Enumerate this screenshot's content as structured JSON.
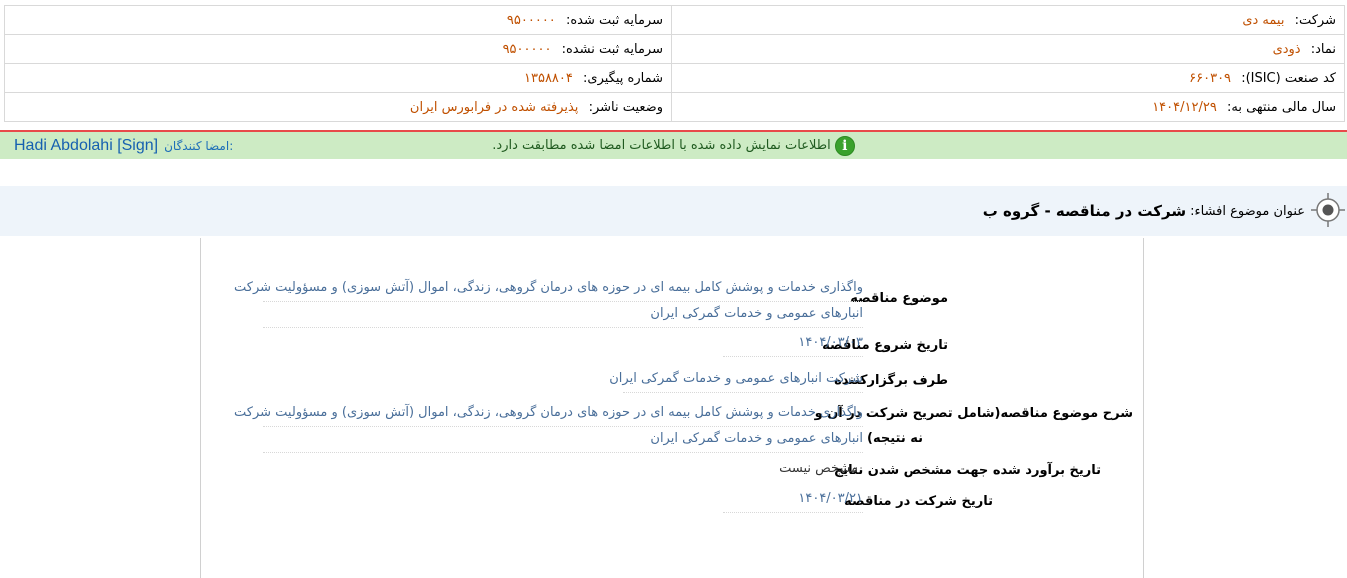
{
  "company": {
    "company_label": "شرکت:",
    "company_value": "بیمه دی",
    "symbol_label": "نماد:",
    "symbol_value": "ذودی",
    "isic_label": "کد صنعت (ISIC):",
    "isic_value": "۶۶۰۳۰۹",
    "fiscal_label": "سال مالی منتهی به:",
    "fiscal_value": "۱۴۰۴/۱۲/۲۹",
    "registered_capital_label": "سرمایه ثبت شده:",
    "registered_capital_value": "۹۵۰۰۰۰۰",
    "unregistered_capital_label": "سرمایه ثبت نشده:",
    "unregistered_capital_value": "۹۵۰۰۰۰۰",
    "tracking_label": "شماره پیگیری:",
    "tracking_value": "۱۳۵۸۸۰۴",
    "publisher_status_label": "وضعیت ناشر:",
    "publisher_status_value": "پذیرفته شده در فرابورس ایران"
  },
  "status": {
    "icon": "info-icon",
    "message": "اطلاعات نمایش داده شده با اطلاعات امضا شده مطابقت دارد.",
    "signers_label": "امضا کنندگان:",
    "signer_name": "Hadi Abdolahi [Sign]",
    "accent_color": "#e84a4a",
    "bar_color": "#cdebc4"
  },
  "disclosure": {
    "title_label": "عنوان موضوع افشاء:",
    "title_value": "شرکت در مناقصه - گروه ب"
  },
  "fields": {
    "subject_label": "موضوع مناقصه",
    "subject_line1": "واگذاری خدمات و پوشش کامل بیمه ای در حوزه های درمان گروهی، زندگی، اموال (آتش سوزی) و مسؤولیت شرکت",
    "subject_line2": "انبارهای عمومی و خدمات گمرکی ایران",
    "start_date_label": "تاریخ شروع مناقصه",
    "start_date_value": "۱۴۰۴/۰۳/۰۳",
    "organizer_label": "طرف برگزارکننده",
    "organizer_value": "شرکت انبارهای عمومی و خدمات گمرکی ایران",
    "description_label_line1": "شرح موضوع مناقصه(شامل تصریح شرکت در آن و",
    "description_label_line2": "نه نتیجه)",
    "description_line1": "واگذاری خدمات و پوشش کامل بیمه ای در حوزه های درمان گروهی، زندگی، اموال (آتش سوزی) و مسؤولیت شرکت",
    "description_line2": "انبارهای عمومی و خدمات گمرکی ایران",
    "estimated_date_label": "تاریخ برآورد شده جهت مشخص شدن نتایج",
    "estimated_date_value": "مشخص نیست",
    "participation_date_label": "تاریخ شرکت در مناقصه",
    "participation_date_value": "۱۴۰۴/۰۳/۲۱"
  }
}
